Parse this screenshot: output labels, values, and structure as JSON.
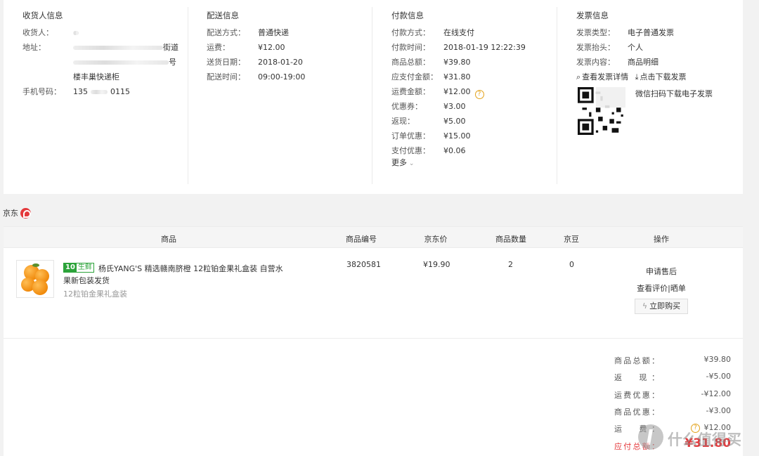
{
  "consignee": {
    "title": "收货人信息",
    "name_label": "收货人：",
    "name_value": "",
    "address_label": "地址：",
    "address_line1_end": "街道",
    "address_line2_end": "号",
    "address_line3": "楼丰巢快递柜",
    "phone_label": "手机号码：",
    "phone_start": "135",
    "phone_end": "0115"
  },
  "delivery": {
    "title": "配送信息",
    "rows": [
      {
        "label": "配送方式：",
        "value": "普通快递"
      },
      {
        "label": "运费：",
        "value": "¥12.00"
      },
      {
        "label": "送货日期：",
        "value": "2018-01-20"
      },
      {
        "label": "配送时间：",
        "value": "09:00-19:00"
      }
    ]
  },
  "payment": {
    "title": "付款信息",
    "rows": [
      {
        "label": "付款方式：",
        "value": "在线支付"
      },
      {
        "label": "付款时间：",
        "value": "2018-01-19 12:22:39"
      },
      {
        "label": "商品总额：",
        "value": "¥39.80"
      },
      {
        "label": "应支付金额：",
        "value": "¥31.80"
      },
      {
        "label": "运费金额：",
        "value": "¥12.00"
      },
      {
        "label": "优惠券：",
        "value": "¥3.00"
      },
      {
        "label": "返现：",
        "value": "¥5.00"
      },
      {
        "label": "订单优惠：",
        "value": "¥15.00"
      },
      {
        "label": "支付优惠：",
        "value": "¥0.06"
      }
    ],
    "more_label": "更多",
    "help_icon_glyph": "?"
  },
  "invoice": {
    "title": "发票信息",
    "rows": [
      {
        "label": "发票类型：",
        "value": "电子普通发票"
      },
      {
        "label": "发票抬头：",
        "value": "个人"
      },
      {
        "label": "发票内容：",
        "value": "商品明细"
      }
    ],
    "view_link": "查看发票详情",
    "download_link": "点击下载发票",
    "qr_caption": "微信扫码下载电子发票"
  },
  "shop": {
    "name": "京东",
    "logo_color": "#e4393c"
  },
  "table": {
    "headers": [
      "商品",
      "商品编号",
      "京东价",
      "商品数量",
      "京豆",
      "操作"
    ],
    "item": {
      "tag_left": "10",
      "tag_right": "生鲜",
      "name": "杨氏YANG'S 精选赣南脐橙 12粒铂金果礼盒装 自营水果新包装发货",
      "spec": "12粒铂金果礼盒装",
      "sku": "3820581",
      "price": "¥19.90",
      "quantity": "2",
      "beans": "0",
      "actions": {
        "after_sale": "申请售后",
        "review_view": "查看评价",
        "review_sep": "|",
        "review_share": "晒单",
        "buy": "立即购买"
      }
    }
  },
  "summary": {
    "rows": [
      {
        "label": "商品总额：",
        "value": "¥39.80"
      },
      {
        "label": "返　现：",
        "value": "-¥5.00"
      },
      {
        "label": "运费优惠：",
        "value": "-¥12.00"
      },
      {
        "label": "商品优惠：",
        "value": "-¥3.00"
      },
      {
        "label": "运　费：",
        "value": "¥12.00"
      }
    ],
    "total_label": "应付总额：",
    "total_value": "¥31.80"
  },
  "watermark": "什么值得买",
  "colors": {
    "accent_red": "#e4393c",
    "fresh_green": "#2ca33a",
    "help_orange": "#e3a21a"
  }
}
